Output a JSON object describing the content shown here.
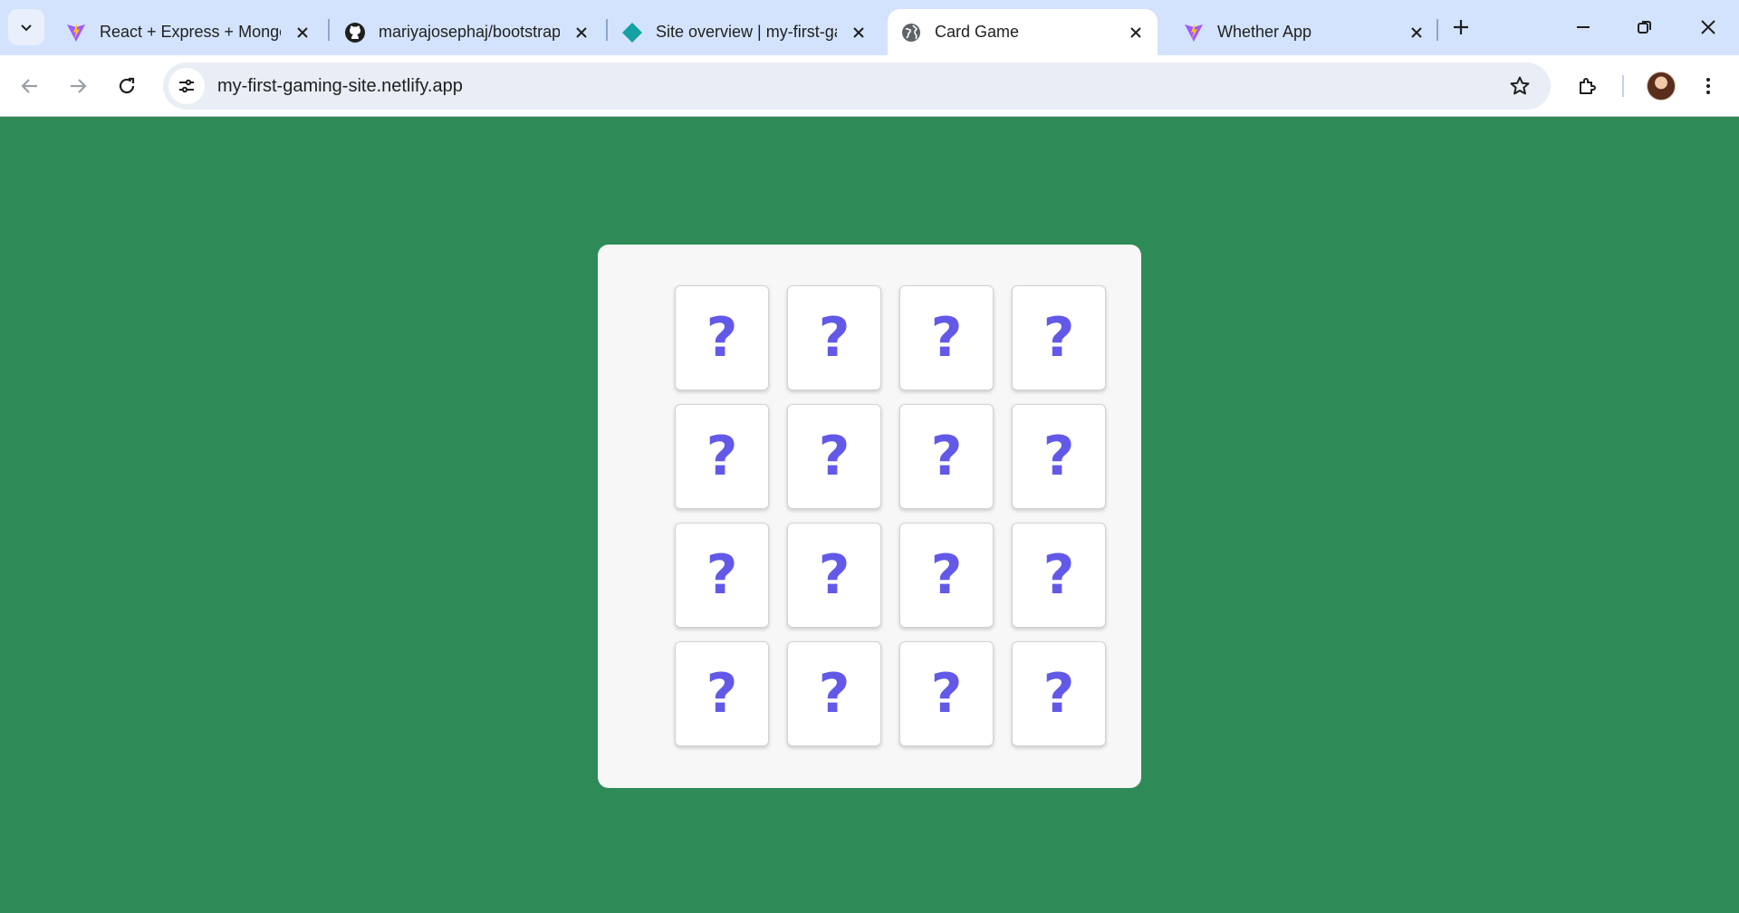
{
  "tabs": [
    {
      "title": "React + Express + Mongo",
      "favicon": "vite-icon",
      "active": false
    },
    {
      "title": "mariyajosephaj/bootstrap",
      "favicon": "github-icon",
      "active": false
    },
    {
      "title": "Site overview | my-first-gaming-site",
      "favicon": "netlify-icon",
      "active": false
    },
    {
      "title": "Card Game",
      "favicon": "globe-icon",
      "active": true
    },
    {
      "title": "Whether App",
      "favicon": "vite-icon",
      "active": false
    }
  ],
  "address_bar": {
    "url": "my-first-gaming-site.netlify.app"
  },
  "game": {
    "mark_color": "#6259e8",
    "cards": [
      "?",
      "?",
      "?",
      "?",
      "?",
      "?",
      "?",
      "?",
      "?",
      "?",
      "?",
      "?",
      "?",
      "?",
      "?",
      "?"
    ]
  },
  "colors": {
    "page_background": "#2e8b57",
    "panel_background": "#f7f7f7",
    "tabstrip": "#d3e3fd"
  }
}
